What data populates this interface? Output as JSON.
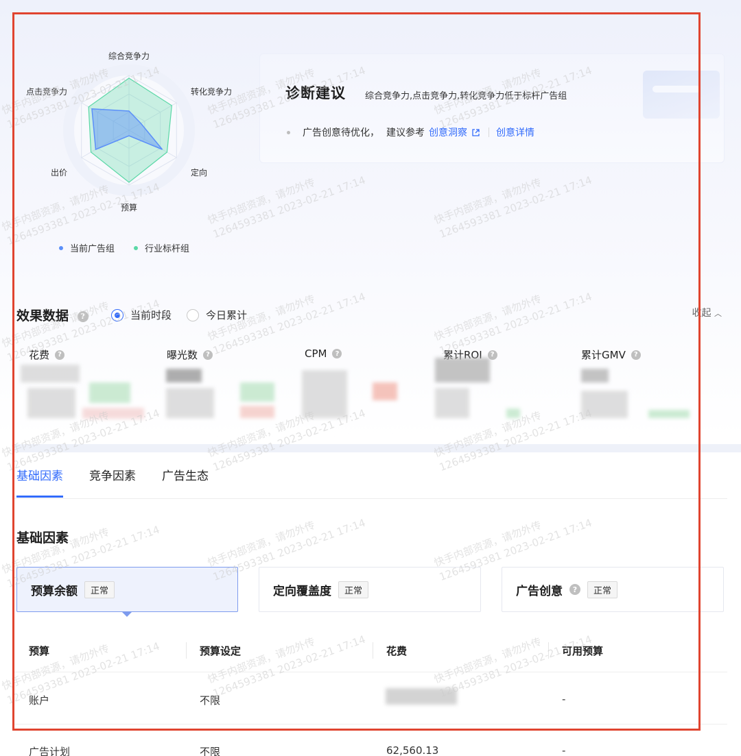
{
  "radar": {
    "axes": [
      "综合竞争力",
      "转化竞争力",
      "定向",
      "预算",
      "出价",
      "点击竞争力"
    ],
    "series": [
      {
        "name": "当前广告组",
        "color": "#5b8ff9",
        "values": [
          0.35,
          0.25,
          0.7,
          0.1,
          0.7,
          0.78
        ]
      },
      {
        "name": "行业标杆组",
        "color": "#5ad8a6",
        "values": [
          0.95,
          0.9,
          0.8,
          0.95,
          0.8,
          0.85
        ]
      }
    ]
  },
  "legend": {
    "current": "当前广告组",
    "benchmark": "行业标杆组"
  },
  "diagnosis": {
    "title": "诊断建议",
    "summary": "综合竞争力,点击竞争力,转化竞争力低于标杆广告组",
    "suggestion_text": "广告创意待优化，",
    "suggestion_prefix": "建议参考",
    "link_insight": "创意洞察",
    "link_detail": "创意详情"
  },
  "effect": {
    "title": "效果数据",
    "radio_current": "当前时段",
    "radio_today": "今日累计",
    "collapse": "收起",
    "metrics": [
      "花费",
      "曝光数",
      "CPM",
      "累计ROI",
      "累计GMV"
    ]
  },
  "tabs": [
    "基础因素",
    "竞争因素",
    "广告生态"
  ],
  "basic": {
    "title": "基础因素",
    "cards": [
      {
        "name": "预算余额",
        "status": "正常"
      },
      {
        "name": "定向覆盖度",
        "status": "正常"
      },
      {
        "name": "广告创意",
        "status": "正常"
      }
    ]
  },
  "table": {
    "headers": [
      "预算",
      "预算设定",
      "花费",
      "可用预算"
    ],
    "rows": [
      {
        "name": "账户",
        "setting": "不限",
        "spend": "",
        "available": "-"
      },
      {
        "name": "广告计划",
        "setting": "不限",
        "spend": "62,560.13",
        "available": "-"
      }
    ]
  },
  "watermark": {
    "line1": "快手内部资源，请勿外传",
    "line2": "1264593381 2023-02-21 17:14"
  },
  "colors": {
    "accent": "#326bfb",
    "highlight": "#e0442f"
  }
}
